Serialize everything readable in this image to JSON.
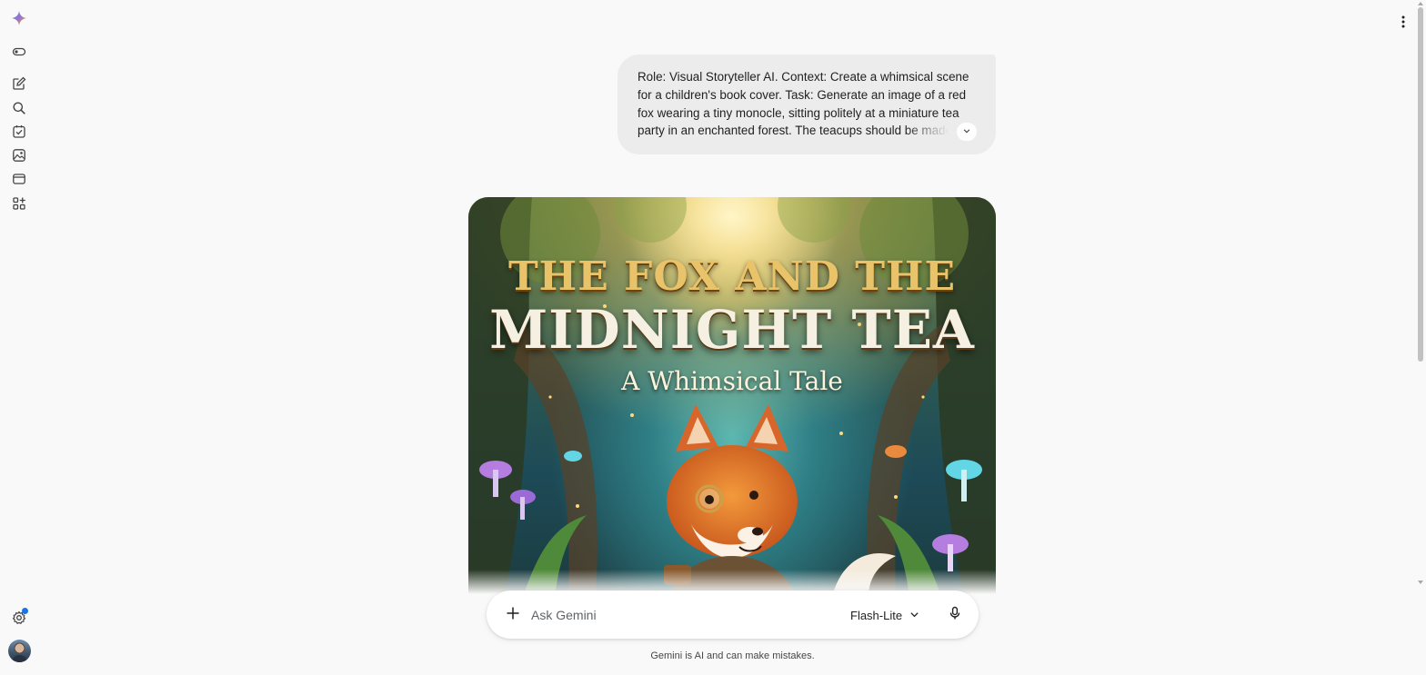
{
  "app": {
    "name": "Gemini"
  },
  "sidebar": {
    "items": [
      {
        "name": "gemini-logo",
        "icon": "sparkle-icon"
      },
      {
        "name": "toggle-sidebar",
        "icon": "toggle-icon"
      },
      {
        "name": "new-chat",
        "icon": "edit-icon"
      },
      {
        "name": "search",
        "icon": "search-icon"
      },
      {
        "name": "my-stuff",
        "icon": "checklist-icon"
      },
      {
        "name": "images",
        "icon": "image-icon"
      },
      {
        "name": "gems",
        "icon": "gem-icon"
      },
      {
        "name": "apps",
        "icon": "apps-icon"
      }
    ],
    "settings_icon": "gear-icon",
    "notification_color": "#1a73e8"
  },
  "conversation": {
    "user_prompt": "Role: Visual Storyteller AI. Context: Create a whimsical scene for a children's book cover. Task: Generate an image of a red fox wearing a tiny monocle, sitting politely at a miniature tea party in an enchanted forest. The teacups should be made",
    "generated_image": {
      "title_line_1": "THE FOX AND THE",
      "title_line_2": "MIDNIGHT TEA",
      "subtitle": "A Whimsical Tale"
    }
  },
  "composer": {
    "placeholder": "Ask Gemini",
    "model_label": "Flash-Lite",
    "disclaimer": "Gemini is AI and can make mistakes."
  },
  "colors": {
    "background": "#f9f9f9",
    "bubble": "#ececec",
    "accent": "#1a73e8"
  }
}
